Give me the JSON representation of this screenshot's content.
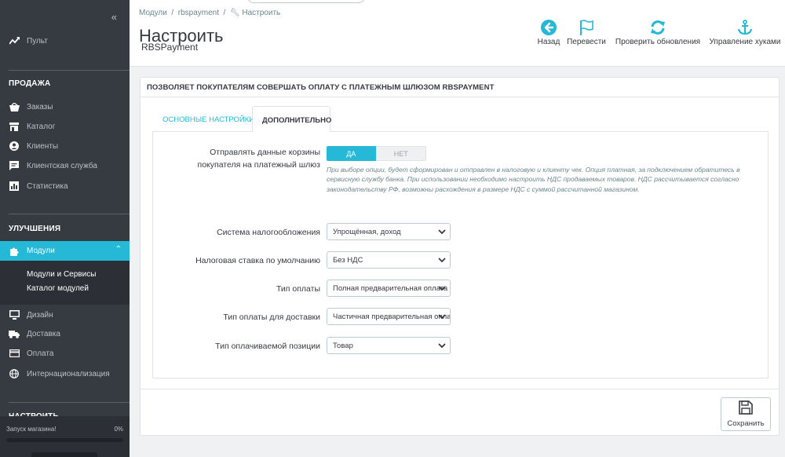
{
  "colors": {
    "accent": "#25b9d7",
    "sidebar_bg": "#363a41",
    "text": "#363a41"
  },
  "sidebar": {
    "collapse_icon": "double-chevron-left-icon",
    "dashboard": {
      "label": "Пульт",
      "icon": "trend-icon"
    },
    "sections": [
      {
        "title": "ПРОДАЖА",
        "items": [
          {
            "label": "Заказы",
            "icon": "shopping-basket-icon"
          },
          {
            "label": "Каталог",
            "icon": "store-icon"
          },
          {
            "label": "Клиенты",
            "icon": "account-circle-icon"
          },
          {
            "label": "Клиентская служба",
            "icon": "chat-icon"
          },
          {
            "label": "Статистика",
            "icon": "bar-chart-icon"
          }
        ]
      },
      {
        "title": "УЛУЧШЕНИЯ",
        "items": [
          {
            "label": "Модули",
            "icon": "puzzle-icon"
          },
          {
            "label": "Дизайн",
            "icon": "desktop-icon"
          },
          {
            "label": "Доставка",
            "icon": "truck-icon"
          },
          {
            "label": "Оплата",
            "icon": "credit-card-icon"
          },
          {
            "label": "Интернационализация",
            "icon": "globe-icon"
          }
        ]
      },
      {
        "title": "НАСТРОИТЬ"
      }
    ],
    "modules_sub": [
      "Модули и Сервисы",
      "Каталог модулей"
    ],
    "store_launch": {
      "label": "Запуск магазина!",
      "percent": "0%",
      "progress": 0
    }
  },
  "header": {
    "breadcrumb": [
      "Модули",
      "rbspayment",
      "Настроить"
    ],
    "title": "Настроить",
    "subtitle": "RBSPayment",
    "toolbar": [
      {
        "label": "Назад",
        "icon": "arrow-left-circle-icon"
      },
      {
        "label": "Перевести",
        "icon": "flag-icon"
      },
      {
        "label": "Проверить обновления",
        "icon": "refresh-icon"
      },
      {
        "label": "Управление хуками",
        "icon": "anchor-icon"
      }
    ]
  },
  "panel": {
    "heading": "Позволяет покупателям совершать оплату с платежным шлюзом RBSPAYMENT",
    "tabs": [
      {
        "label": "Основные настройки",
        "active": false
      },
      {
        "label": "Дополнительно",
        "active": true
      }
    ],
    "fields": {
      "send_cart": {
        "label_line1": "Отправлять данные корзины",
        "label_line2": "покупателя на платежный шлюз",
        "yes": "ДА",
        "no": "НЕТ",
        "value": "ДА",
        "help": "При выборе опции, будет сформирован и отправлен в налоговую и клиенту чек. Опция платная, за подключением обратитесь в сервисную службу банка. При использовании необходимо настроить НДС продаваемых товаров. НДС рассчитывается согласно законодательству РФ, возможны расхождения в размере НДС с суммой рассчитанной магазином."
      },
      "tax_system": {
        "label": "Система налогообложения",
        "value": "Упрощённая, доход"
      },
      "default_tax": {
        "label": "Налоговая ставка по умолчанию",
        "value": "Без НДС"
      },
      "payment_type": {
        "label": "Тип оплаты",
        "value": "Полная предварительная оплата"
      },
      "delivery_payment_type": {
        "label": "Тип оплаты для доставки",
        "value": "Частичная предварительная оплата"
      },
      "item_type": {
        "label": "Тип оплачиваемой позиции",
        "value": "Товар"
      }
    },
    "save_label": "Сохранить"
  }
}
